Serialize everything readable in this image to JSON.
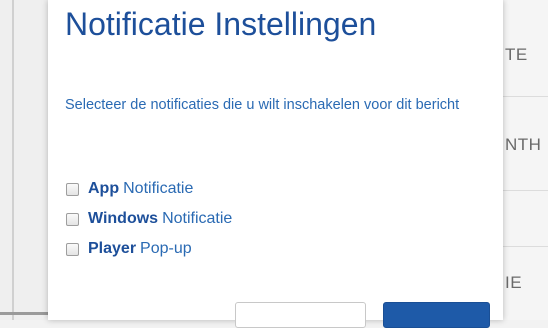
{
  "background": {
    "table_cells": [
      "TE",
      "NTH",
      "IE"
    ]
  },
  "modal": {
    "title": "Notificatie Instellingen",
    "description": "Selecteer de notificaties die u wilt inschakelen voor dit bericht",
    "options": [
      {
        "strong": "App",
        "rest": "Notificatie",
        "checked": false
      },
      {
        "strong": "Windows",
        "rest": "Notificatie",
        "checked": false
      },
      {
        "strong": "Player",
        "rest": "Pop-up",
        "checked": false
      }
    ]
  },
  "colors": {
    "title": "#1d4f9a",
    "text": "#2a6ab3",
    "primary_button": "#1e5aa8"
  }
}
